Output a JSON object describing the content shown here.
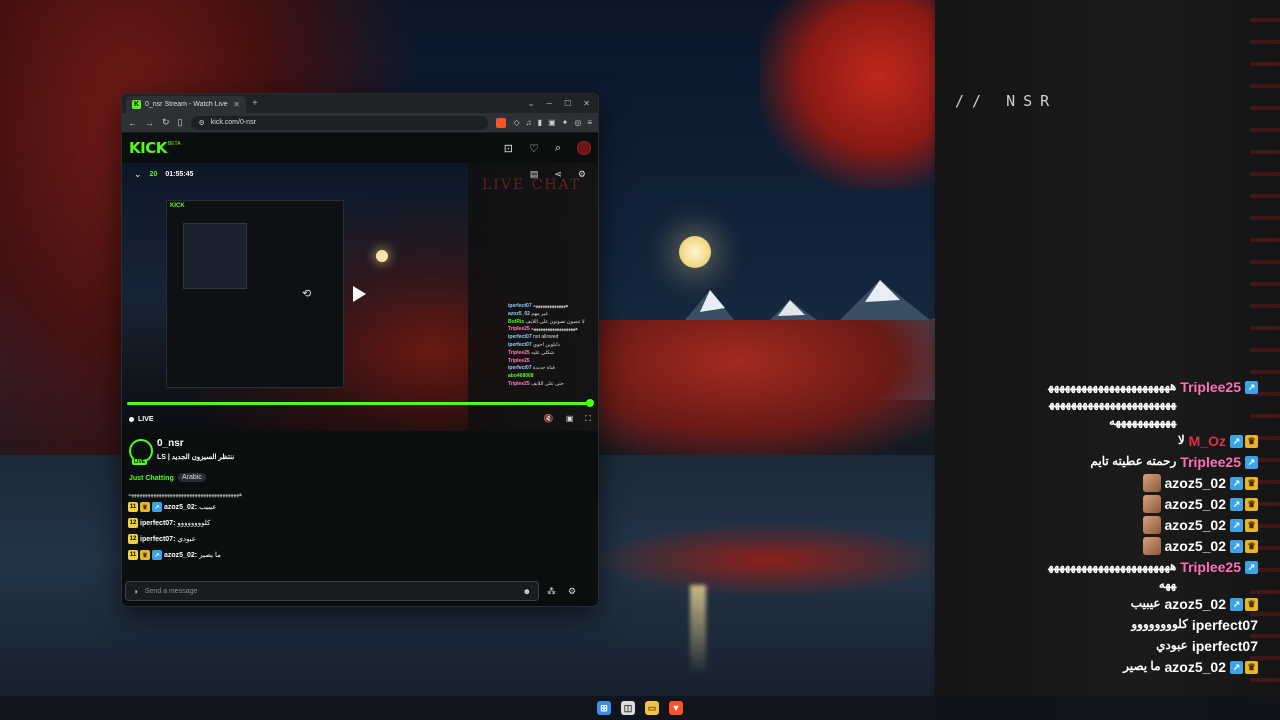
{
  "overlay": {
    "title": "// NSR",
    "messages": [
      {
        "user": "Triplee25",
        "user_color": "#ff6fb8",
        "badges": [
          "blue"
        ],
        "text": "هههههههههههههههههههههههههههههههههههههههههههههههههههههههههه",
        "avatar": false
      },
      {
        "user": "M_Oz",
        "user_color": "#e0304a",
        "badges": [
          "blue",
          "gold"
        ],
        "text": "لا",
        "avatar": false
      },
      {
        "user": "Triplee25",
        "user_color": "#ff6fb8",
        "badges": [
          "blue"
        ],
        "text": "رحمته عطيته تايم",
        "avatar": false
      },
      {
        "user": "azoz5_02",
        "user_color": "#ffffff",
        "badges": [
          "blue",
          "gold"
        ],
        "text": "",
        "avatar": true
      },
      {
        "user": "azoz5_02",
        "user_color": "#ffffff",
        "badges": [
          "blue",
          "gold"
        ],
        "text": "",
        "avatar": true
      },
      {
        "user": "azoz5_02",
        "user_color": "#ffffff",
        "badges": [
          "blue",
          "gold"
        ],
        "text": "",
        "avatar": true
      },
      {
        "user": "azoz5_02",
        "user_color": "#ffffff",
        "badges": [
          "blue",
          "gold"
        ],
        "text": "",
        "avatar": true
      },
      {
        "user": "Triplee25",
        "user_color": "#ff6fb8",
        "badges": [
          "blue"
        ],
        "text": "هههههههههههههههههههههههههه",
        "avatar": false
      },
      {
        "user": "azoz5_02",
        "user_color": "#ffffff",
        "badges": [
          "blue",
          "gold"
        ],
        "text": "عيبيب",
        "avatar": false
      },
      {
        "user": "iperfect07",
        "user_color": "#ffffff",
        "badges": [],
        "text": "كلوووووووو",
        "avatar": false
      },
      {
        "user": "iperfect07",
        "user_color": "#ffffff",
        "badges": [],
        "text": "عبودي",
        "avatar": false
      },
      {
        "user": "azoz5_02",
        "user_color": "#ffffff",
        "badges": [
          "blue",
          "gold"
        ],
        "text": "ما يصير",
        "avatar": false
      }
    ]
  },
  "browser": {
    "tab_title": "0_nsr Stream - Watch Live on Ki...",
    "url": "kick.com/0-nsr",
    "logo": "KICK",
    "logo_beta": "BETA"
  },
  "player": {
    "viewers": "20",
    "uptime": "01:55:45",
    "live_label": "LIVE",
    "overlay_title": "LIVE CHAT",
    "progress_fraction": 1.0,
    "chat_lines": [
      {
        "user": "iperfect07",
        "text": "ههههههههههههههه",
        "color": "blue"
      },
      {
        "user": "azoz5_02",
        "text": "غير مهم",
        "color": "blue"
      },
      {
        "user": "BotRix",
        "text": "لا تنسون تصوتون على اللايف",
        "color": "green"
      },
      {
        "user": "Triplee25",
        "text": "هههههههههههههههههههه",
        "color": "pink"
      },
      {
        "user": "iperfect07",
        "text": "not allowed",
        "color": "blue"
      },
      {
        "user": "iperfect07",
        "text": "دابلوين اخوي",
        "color": "blue"
      },
      {
        "user": "Triplee25",
        "text": "شكلي عليه",
        "color": "pink"
      },
      {
        "user": "Triplee25",
        "text": "",
        "color": "pink"
      },
      {
        "user": "iperfect07",
        "text": "قناة جديدة",
        "color": "blue"
      },
      {
        "user": "abo468068",
        "text": "",
        "color": "green"
      },
      {
        "user": "Triplee25",
        "text": "حتى على اللايف",
        "color": "pink"
      }
    ]
  },
  "channel": {
    "name": "0_nsr",
    "title": "LS | ننتظر السيزون الجديد",
    "category": "Just Chatting",
    "tag": "Arabic",
    "live_badge": "LIVE"
  },
  "chat": {
    "cut_line": "ههههههههههههههههههههههههههههههههههههههههه",
    "lines": [
      {
        "badges": [
          "yellow",
          "gold",
          "blue"
        ],
        "badge_text": "11",
        "user": "azoz5_02:",
        "text": "عيبيب"
      },
      {
        "badges": [
          "yellow"
        ],
        "badge_text": "12",
        "user": "iperfect07:",
        "text": "كلوووووووو"
      },
      {
        "badges": [
          "yellow"
        ],
        "badge_text": "12",
        "user": "iperfect07:",
        "text": "عبودي"
      },
      {
        "badges": [
          "yellow",
          "gold",
          "blue"
        ],
        "badge_text": "11",
        "user": "azoz5_02:",
        "text": "ما يصير"
      }
    ],
    "placeholder": "Send a message"
  }
}
